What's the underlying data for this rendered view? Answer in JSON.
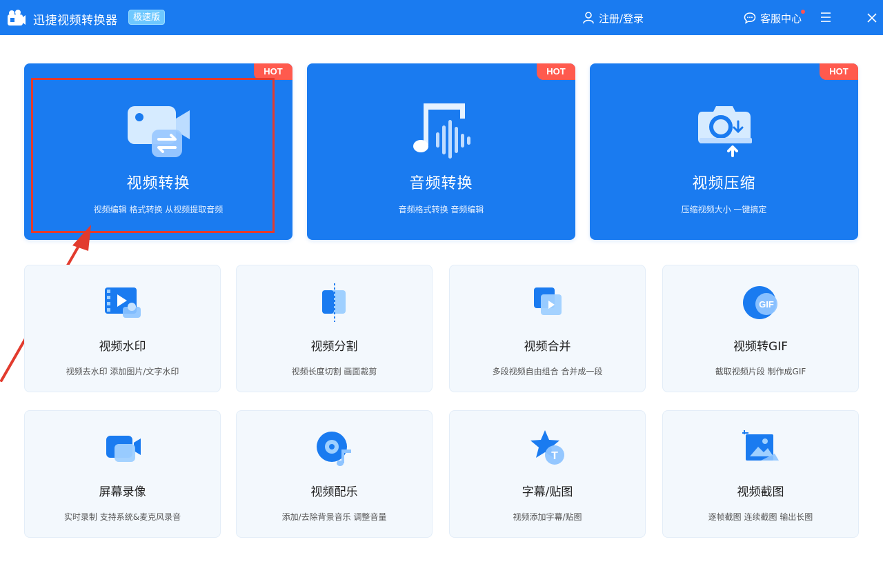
{
  "header": {
    "app_title": "迅捷视频转换器",
    "edition": "极速版",
    "login_label": "注册/登录",
    "support_label": "客服中心"
  },
  "colors": {
    "brand_blue": "#1a7bf0",
    "hot_red": "#ff5a4e",
    "annotation_red": "#e23b2e",
    "card_bg": "#f3f8fd"
  },
  "hot_cards": [
    {
      "title": "视频转换",
      "desc": "视频编辑 格式转换 从视频提取音频",
      "badge": "HOT",
      "icon": "video-convert-icon"
    },
    {
      "title": "音频转换",
      "desc": "音频格式转换 音频编辑",
      "badge": "HOT",
      "icon": "music-note-icon"
    },
    {
      "title": "视频压缩",
      "desc": "压缩视频大小 一键搞定",
      "badge": "HOT",
      "icon": "camera-compress-icon"
    }
  ],
  "tools": [
    {
      "title": "视频水印",
      "desc": "视频去水印 添加图片/文字水印",
      "icon": "watermark-icon"
    },
    {
      "title": "视频分割",
      "desc": "视频长度切割 画面裁剪",
      "icon": "split-icon"
    },
    {
      "title": "视频合并",
      "desc": "多段视频自由组合 合并成一段",
      "icon": "merge-icon"
    },
    {
      "title": "视频转GIF",
      "desc": "截取视频片段 制作成GIF",
      "icon": "gif-icon",
      "icon_text": "GIF"
    },
    {
      "title": "屏幕录像",
      "desc": "实时录制 支持系统&麦克风录音",
      "icon": "screen-record-icon"
    },
    {
      "title": "视频配乐",
      "desc": "添加/去除背景音乐 调整音量",
      "icon": "music-disc-icon"
    },
    {
      "title": "字幕/贴图",
      "desc": "视频添加字幕/贴图",
      "icon": "subtitle-star-icon",
      "icon_text": "T"
    },
    {
      "title": "视频截图",
      "desc": "逐帧截图 连续截图 输出长图",
      "icon": "screenshot-image-icon"
    }
  ]
}
